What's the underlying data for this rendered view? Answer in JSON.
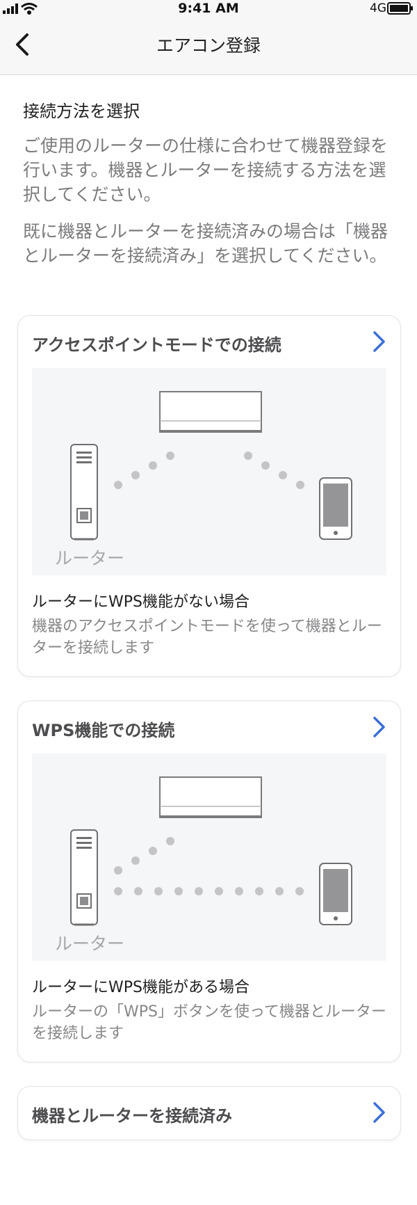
{
  "status_bar": {
    "time": "9:41 AM",
    "network": "4G"
  },
  "nav": {
    "title": "エアコン登録"
  },
  "intro": {
    "heading": "接続方法を選択",
    "paragraph_1": "ご使用のルーターの仕様に合わせて機器登録を行います。機器とルーターを接続する方法を選択してください。",
    "paragraph_2": "既に機器とルーターを接続済みの場合は「機器とルーターを接続済み」を選択してください。"
  },
  "options": [
    {
      "title": "アクセスポイントモードでの接続",
      "illustration_label": "ルーター",
      "subtitle": "ルーターにWPS機能がない場合",
      "description": "機器のアクセスポイントモードを使って機器とルーターを接続します"
    },
    {
      "title": "WPS機能での接続",
      "illustration_label": "ルーター",
      "subtitle": "ルーターにWPS機能がある場合",
      "description": "ルーターの「WPS」ボタンを使って機器とルーターを接続します"
    },
    {
      "title": "機器とルーターを接続済み"
    }
  ],
  "icons": {
    "back": "chevron-left-icon",
    "next": "chevron-right-icon",
    "signal": "signal-icon",
    "wifi": "wifi-icon",
    "battery": "battery-icon",
    "router": "router-icon",
    "air_conditioner": "air-conditioner-icon",
    "smartphone": "smartphone-icon"
  },
  "colors": {
    "accent": "#3b6fd8",
    "nav_background": "#f7f7f8",
    "illustration_background": "#f5f6f8",
    "secondary_text": "#7b7b7e"
  }
}
